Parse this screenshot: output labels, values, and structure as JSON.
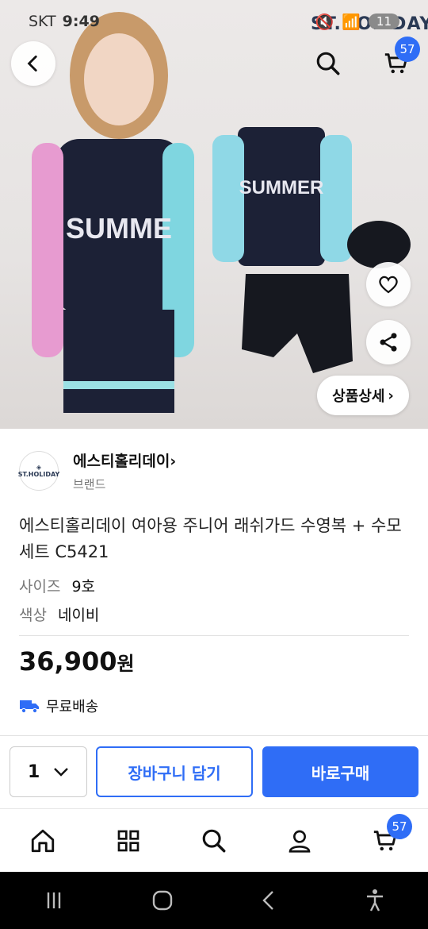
{
  "status": {
    "carrier": "SKT",
    "time": "9:49",
    "battery": "11"
  },
  "hero": {
    "brand_watermark": "ST.HOLIDAY",
    "cart_count": "57",
    "detail_label": "상품상세"
  },
  "seller": {
    "name": "에스티홀리데이",
    "type": "브랜드",
    "logo_text": "ST.HOLIDAY"
  },
  "product": {
    "title": "에스티홀리데이 여아용 주니어 래쉬가드 수영복 + 수모 세트 C5421",
    "options": [
      {
        "key": "사이즈",
        "value": "9호"
      },
      {
        "key": "색상",
        "value": "네이비"
      }
    ],
    "price": "36,900",
    "price_unit": "원",
    "shipping": "무료배송"
  },
  "purchase": {
    "quantity": "1",
    "add_to_cart": "장바구니 담기",
    "buy_now": "바로구매"
  },
  "tabbar": {
    "cart_count": "57",
    "icons": [
      "home-icon",
      "grid-icon",
      "search-icon",
      "user-icon",
      "cart-icon"
    ]
  },
  "colors": {
    "accent": "#2f6df6",
    "shipping_truck": "#2f6df6"
  }
}
